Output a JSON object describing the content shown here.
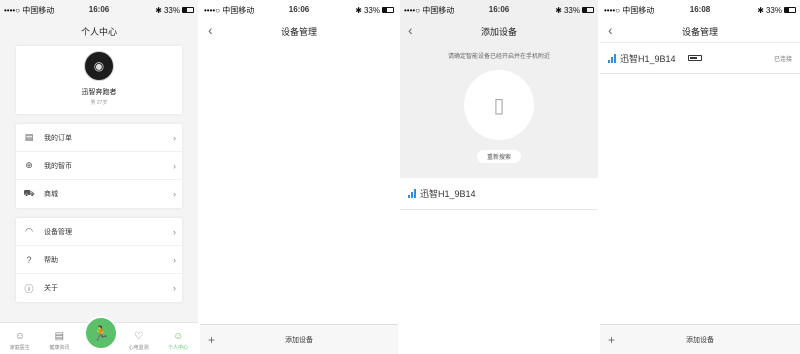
{
  "status_bar": [
    {
      "carrier": "••••○ 中国移动",
      "time": "16:06",
      "battery": "33%"
    },
    {
      "carrier": "••••○ 中国移动",
      "time": "16:06",
      "battery": "33%"
    },
    {
      "carrier": "••••○ 中国移动",
      "time": "16:06",
      "battery": "33%"
    },
    {
      "carrier": "••••○ 中国移动",
      "time": "16:08",
      "battery": "33%"
    }
  ],
  "screen1": {
    "title": "个人中心",
    "profile": {
      "name": "迅智奔跑者",
      "sub": "男 27岁"
    },
    "menu_group1": [
      {
        "label": "我的订单",
        "icon": "order-icon"
      },
      {
        "label": "我的智币",
        "icon": "coin-icon"
      },
      {
        "label": "商城",
        "icon": "cart-icon"
      }
    ],
    "menu_group2": [
      {
        "label": "设备管理",
        "icon": "device-icon"
      },
      {
        "label": "帮助",
        "icon": "help-icon"
      },
      {
        "label": "关于",
        "icon": "about-icon"
      }
    ],
    "tabs": [
      {
        "label": "家庭医生",
        "icon": "doctor-icon"
      },
      {
        "label": "健康资讯",
        "icon": "news-icon"
      },
      {
        "label": "",
        "icon": "run-icon"
      },
      {
        "label": "心电监测",
        "icon": "heart-icon"
      },
      {
        "label": "个人中心",
        "icon": "person-icon"
      }
    ]
  },
  "screen2": {
    "title": "设备管理",
    "add_label": "添加设备"
  },
  "screen3": {
    "title": "添加设备",
    "hint": "请确定智能设备已经开启并在手机附近",
    "rescan_label": "重新搜索",
    "device": "迅智H1_9B14"
  },
  "screen4": {
    "title": "设备管理",
    "device": "迅智H1_9B14",
    "status": "已连接",
    "add_label": "添加设备"
  },
  "colors": {
    "accent_green": "#5cc06a",
    "signal_blue": "#2f8fd8"
  }
}
